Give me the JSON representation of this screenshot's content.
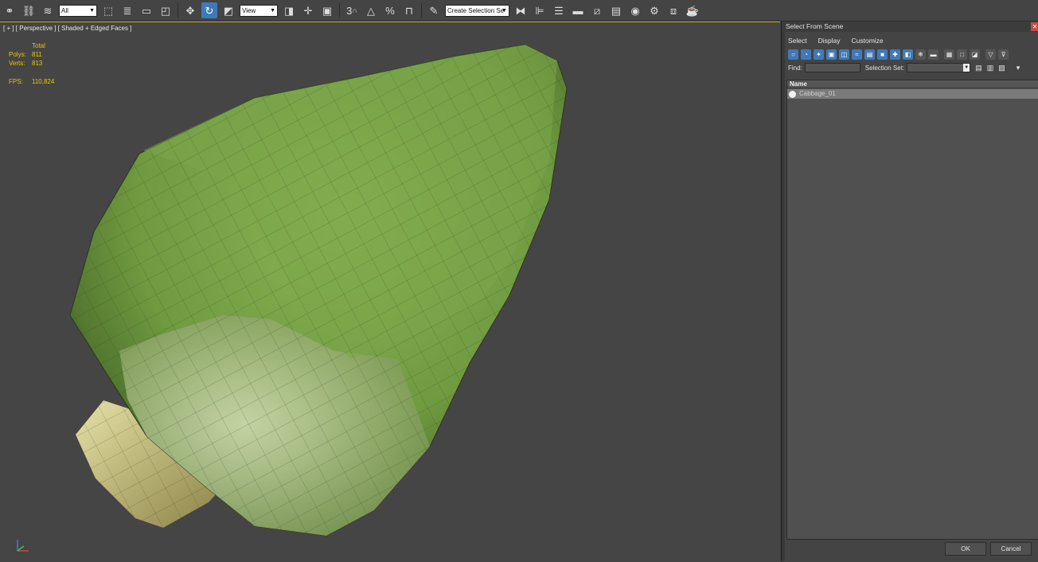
{
  "toolbar": {
    "filter_select": "All",
    "coord_select": "View",
    "selection_set_select": "Create Selection Se",
    "icons": [
      "link-icon",
      "unlink-icon",
      "bind-spacewarp-icon",
      "select-object-icon",
      "select-by-name-icon",
      "rect-region-icon",
      "window-crossing-icon",
      "move-icon",
      "rotate-icon",
      "scale-icon",
      "pivot-icon",
      "snaps-3d-icon",
      "angle-snap-icon",
      "percent-snap-icon",
      "spinner-snap-icon",
      "named-sel-icon",
      "mirror-icon",
      "align-icon",
      "layer-icon",
      "render-setup-icon",
      "material-editor-icon",
      "render-frame-icon",
      "render-icon",
      "teapot-icon"
    ],
    "snap_label": "3",
    "percent_label": "%"
  },
  "viewport": {
    "label": "[ + ] [ Perspective ] [ Shaded + Edged Faces ]",
    "stats": {
      "header": "Total",
      "polys_label": "Polys:",
      "polys_value": "811",
      "verts_label": "Verts:",
      "verts_value": "813",
      "fps_label": "FPS:",
      "fps_value": "110,824"
    }
  },
  "dialog": {
    "title": "Select From Scene",
    "menu": [
      "Select",
      "Display",
      "Customize"
    ],
    "find_label": "Find:",
    "find_value": "",
    "selection_set_label": "Selection Set:",
    "selection_set_value": "",
    "column_name": "Name",
    "rows": [
      "Cabbage_01"
    ],
    "ok": "OK",
    "cancel": "Cancel"
  },
  "colors": {
    "viewport_border": "#e0b000",
    "stats_text": "#e8c800",
    "accent": "#3f7ab8"
  }
}
